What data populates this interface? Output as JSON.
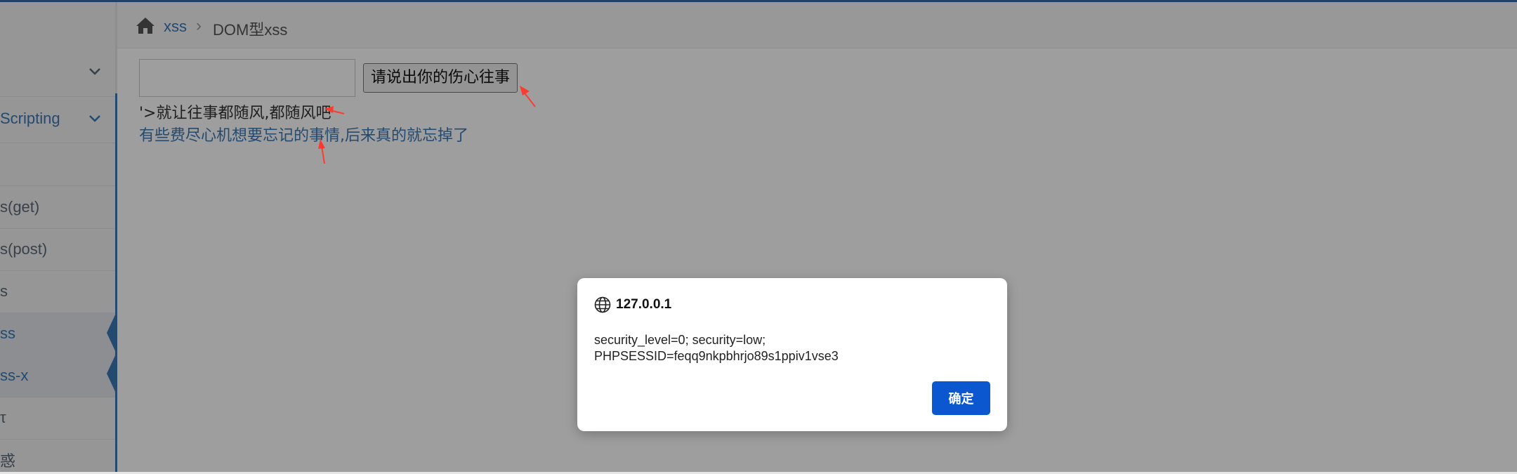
{
  "breadcrumb": {
    "home_icon": "home-icon",
    "link": "xss",
    "separator": "›",
    "current": "DOM型xss"
  },
  "sidebar": {
    "items": [
      {
        "label": "",
        "icon": "chevron-down-icon"
      },
      {
        "label": "Scripting",
        "icon": "chevron-down-icon",
        "active": true
      },
      {
        "label": ""
      },
      {
        "label": "s(get)"
      },
      {
        "label": "s(post)"
      },
      {
        "label": "s"
      },
      {
        "label": "ss",
        "active": true
      },
      {
        "label": "ss-x",
        "active": true
      },
      {
        "label": "τ"
      },
      {
        "label": "惑"
      }
    ]
  },
  "main": {
    "input_value": "",
    "button_label": "请说出你的伤心往事",
    "output_text": "'>就让往事都随风,都随风吧",
    "output_link": "有些费尽心机想要忘记的事情,后来真的就忘掉了"
  },
  "dialog": {
    "origin": "127.0.0.1",
    "message_line1": "security_level=0; security=low;",
    "message_line2": "PHPSESSID=feqq9nkpbhrjo89s1ppiv1vse3",
    "ok_label": "确定"
  },
  "colors": {
    "accent": "#3a78b5",
    "dialog_button": "#0b57d0",
    "annotation": "#ff3b30"
  }
}
